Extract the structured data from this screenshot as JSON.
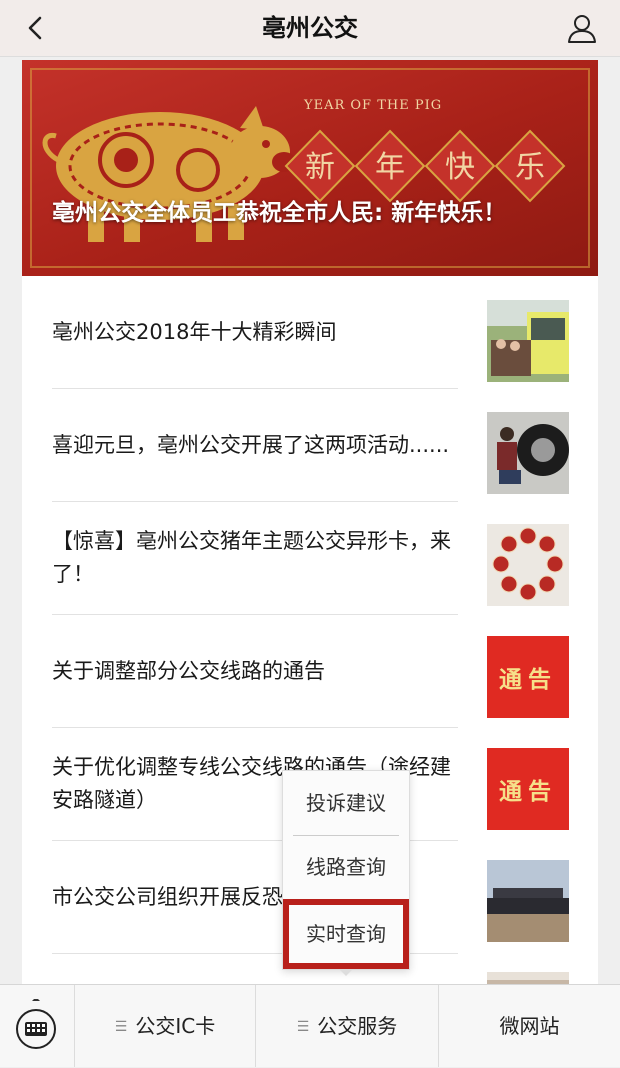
{
  "header": {
    "title": "亳州公交",
    "back_icon": "chevron-left-icon",
    "user_icon": "user-icon"
  },
  "banner": {
    "caption": "亳州公交全体员工恭祝全市人民: 新年快乐！",
    "year_text": "YEAR OF THE PIG",
    "chars": [
      "新",
      "年",
      "快",
      "乐"
    ],
    "colors": {
      "red": "#b0241b",
      "gold": "#d9a441"
    }
  },
  "articles": [
    {
      "title": "亳州公交2018年十大精彩瞬间",
      "thumb": "bus-photo"
    },
    {
      "title": "喜迎元旦，亳州公交开展了这两项活动......",
      "thumb": "tire-repair-photo"
    },
    {
      "title": "【惊喜】亳州公交猪年主题公交异形卡，来了！",
      "thumb": "bus-cards-photo"
    },
    {
      "title": "关于调整部分公交线路的通告",
      "thumb": "notice-badge",
      "badge": "通告"
    },
    {
      "title": "关于优化调整专线公交线路的通告（途经建安路隧道）",
      "thumb": "notice-badge",
      "badge": "通告"
    },
    {
      "title": "市公交公司组织开展反恐防暴应急演练",
      "thumb": "drill-photo"
    }
  ],
  "popup_menu": {
    "items": [
      "投诉建议",
      "线路查询",
      "实时查询"
    ],
    "highlighted": "实时查询"
  },
  "bottom_bar": {
    "keyboard_icon": "keyboard-icon",
    "tabs": [
      "公交IC卡",
      "公交服务",
      "微网站"
    ],
    "menu_icon": "menu-lines-icon"
  }
}
